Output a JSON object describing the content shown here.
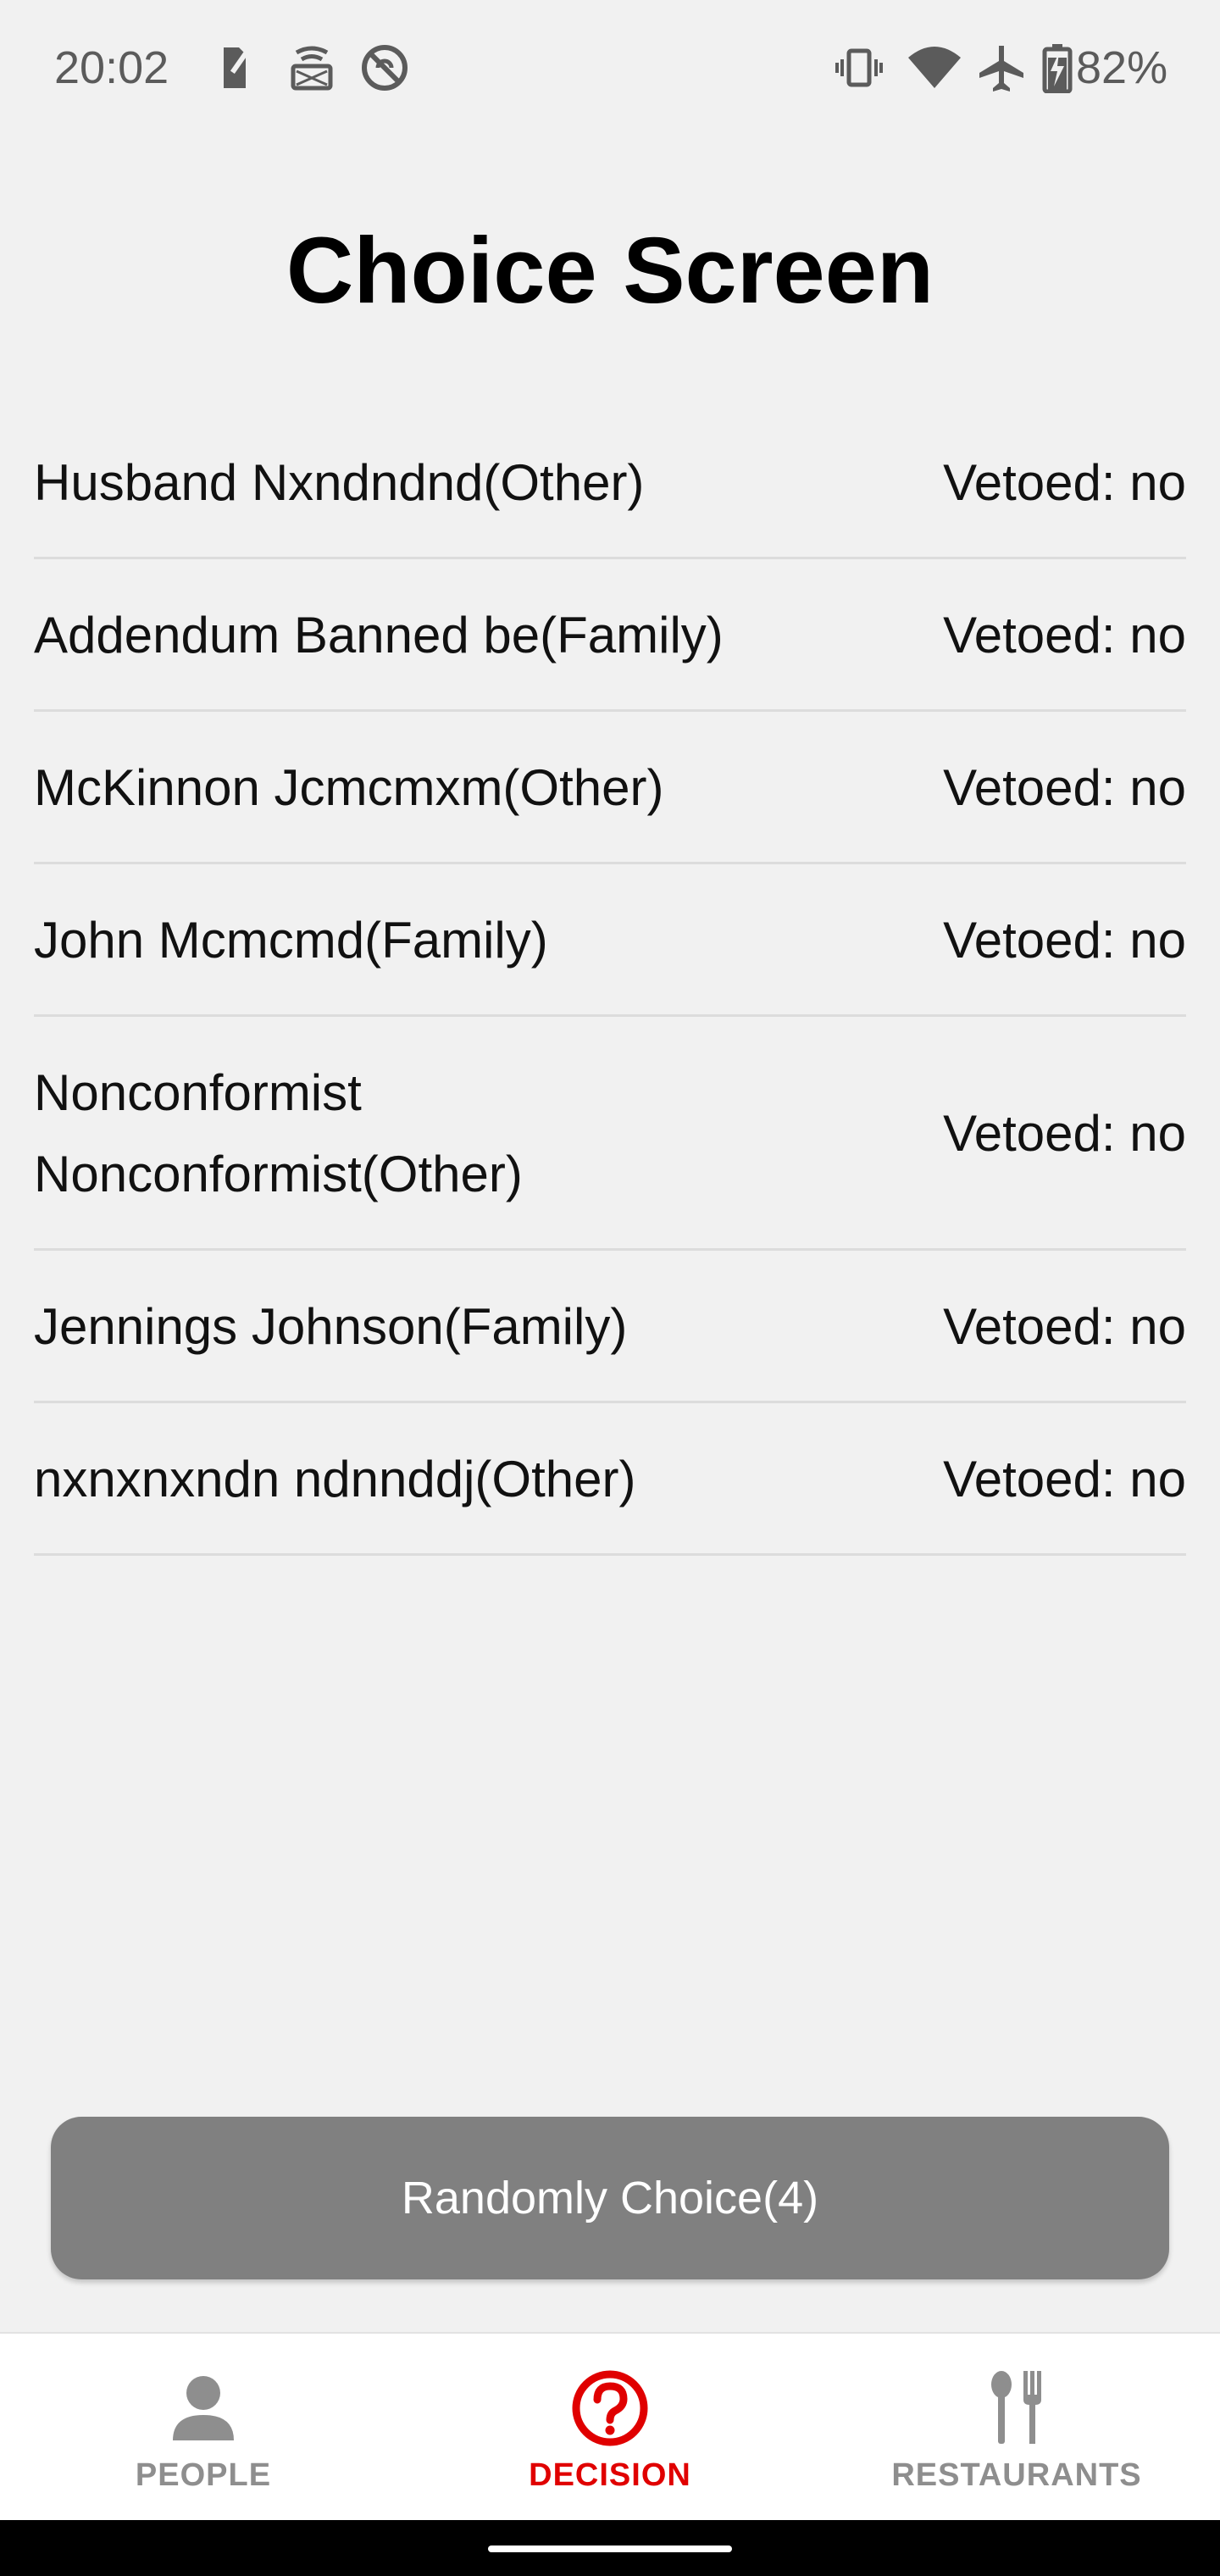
{
  "status_bar": {
    "time": "20:02",
    "battery": "82%",
    "icons": [
      "sim-card-icon",
      "cast-icon",
      "do-not-disturb-icon",
      "vibrate-icon",
      "wifi-icon",
      "airplane-icon",
      "battery-charging-icon"
    ]
  },
  "page": {
    "title": "Choice Screen"
  },
  "list": {
    "items": [
      {
        "name": "Husband Nxndndnd(Other)",
        "veto": "Vetoed: no"
      },
      {
        "name": "Addendum Banned be(Family)",
        "veto": "Vetoed: no"
      },
      {
        "name": "McKinnon Jcmcmxm(Other)",
        "veto": "Vetoed: no"
      },
      {
        "name": "John Mcmcmd(Family)",
        "veto": "Vetoed: no"
      },
      {
        "name": "Nonconformist Nonconformist(Other)",
        "name_line1": "Nonconformist",
        "name_line2": "Nonconformist(Other)",
        "veto": "Vetoed: no"
      },
      {
        "name": "Jennings Johnson(Family)",
        "veto": "Vetoed: no"
      },
      {
        "name": "nxnxnxndn ndnnddj(Other)",
        "veto": "Vetoed: no"
      }
    ]
  },
  "action": {
    "random_button_label": "Randomly Choice(4)"
  },
  "bottom_nav": {
    "items": [
      {
        "label": "PEOPLE",
        "icon": "person-icon",
        "active": false
      },
      {
        "label": "DECISION",
        "icon": "question-circle-icon",
        "active": true
      },
      {
        "label": "RESTAURANTS",
        "icon": "fork-spoon-icon",
        "active": false
      }
    ]
  },
  "colors": {
    "background": "#f1f1f1",
    "accent": "#e00000",
    "button": "#808080",
    "nav_inactive": "#8e8e8e"
  }
}
